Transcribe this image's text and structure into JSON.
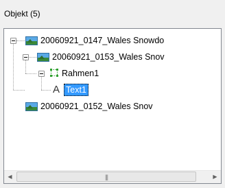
{
  "panel": {
    "title": "Objekt (5)"
  },
  "tree": {
    "nodes": [
      {
        "label": "20060921_0147_Wales Snowdo",
        "icon": "image-icon",
        "expanded": true
      },
      {
        "label": "20060921_0153_Wales Snov",
        "icon": "image-icon",
        "expanded": true
      },
      {
        "label": "Rahmen1",
        "icon": "frame-icon",
        "expanded": true
      },
      {
        "label": "Text1",
        "icon": "text-icon",
        "selected": true
      },
      {
        "label": "20060921_0152_Wales Snov",
        "icon": "image-icon"
      }
    ]
  },
  "scrollbar": {
    "left_arrow": "◀",
    "right_arrow": "▶",
    "grip": "|||"
  },
  "colors": {
    "selection": "#3399ff",
    "border": "#828790",
    "frame_icon": "#2fa02f"
  }
}
